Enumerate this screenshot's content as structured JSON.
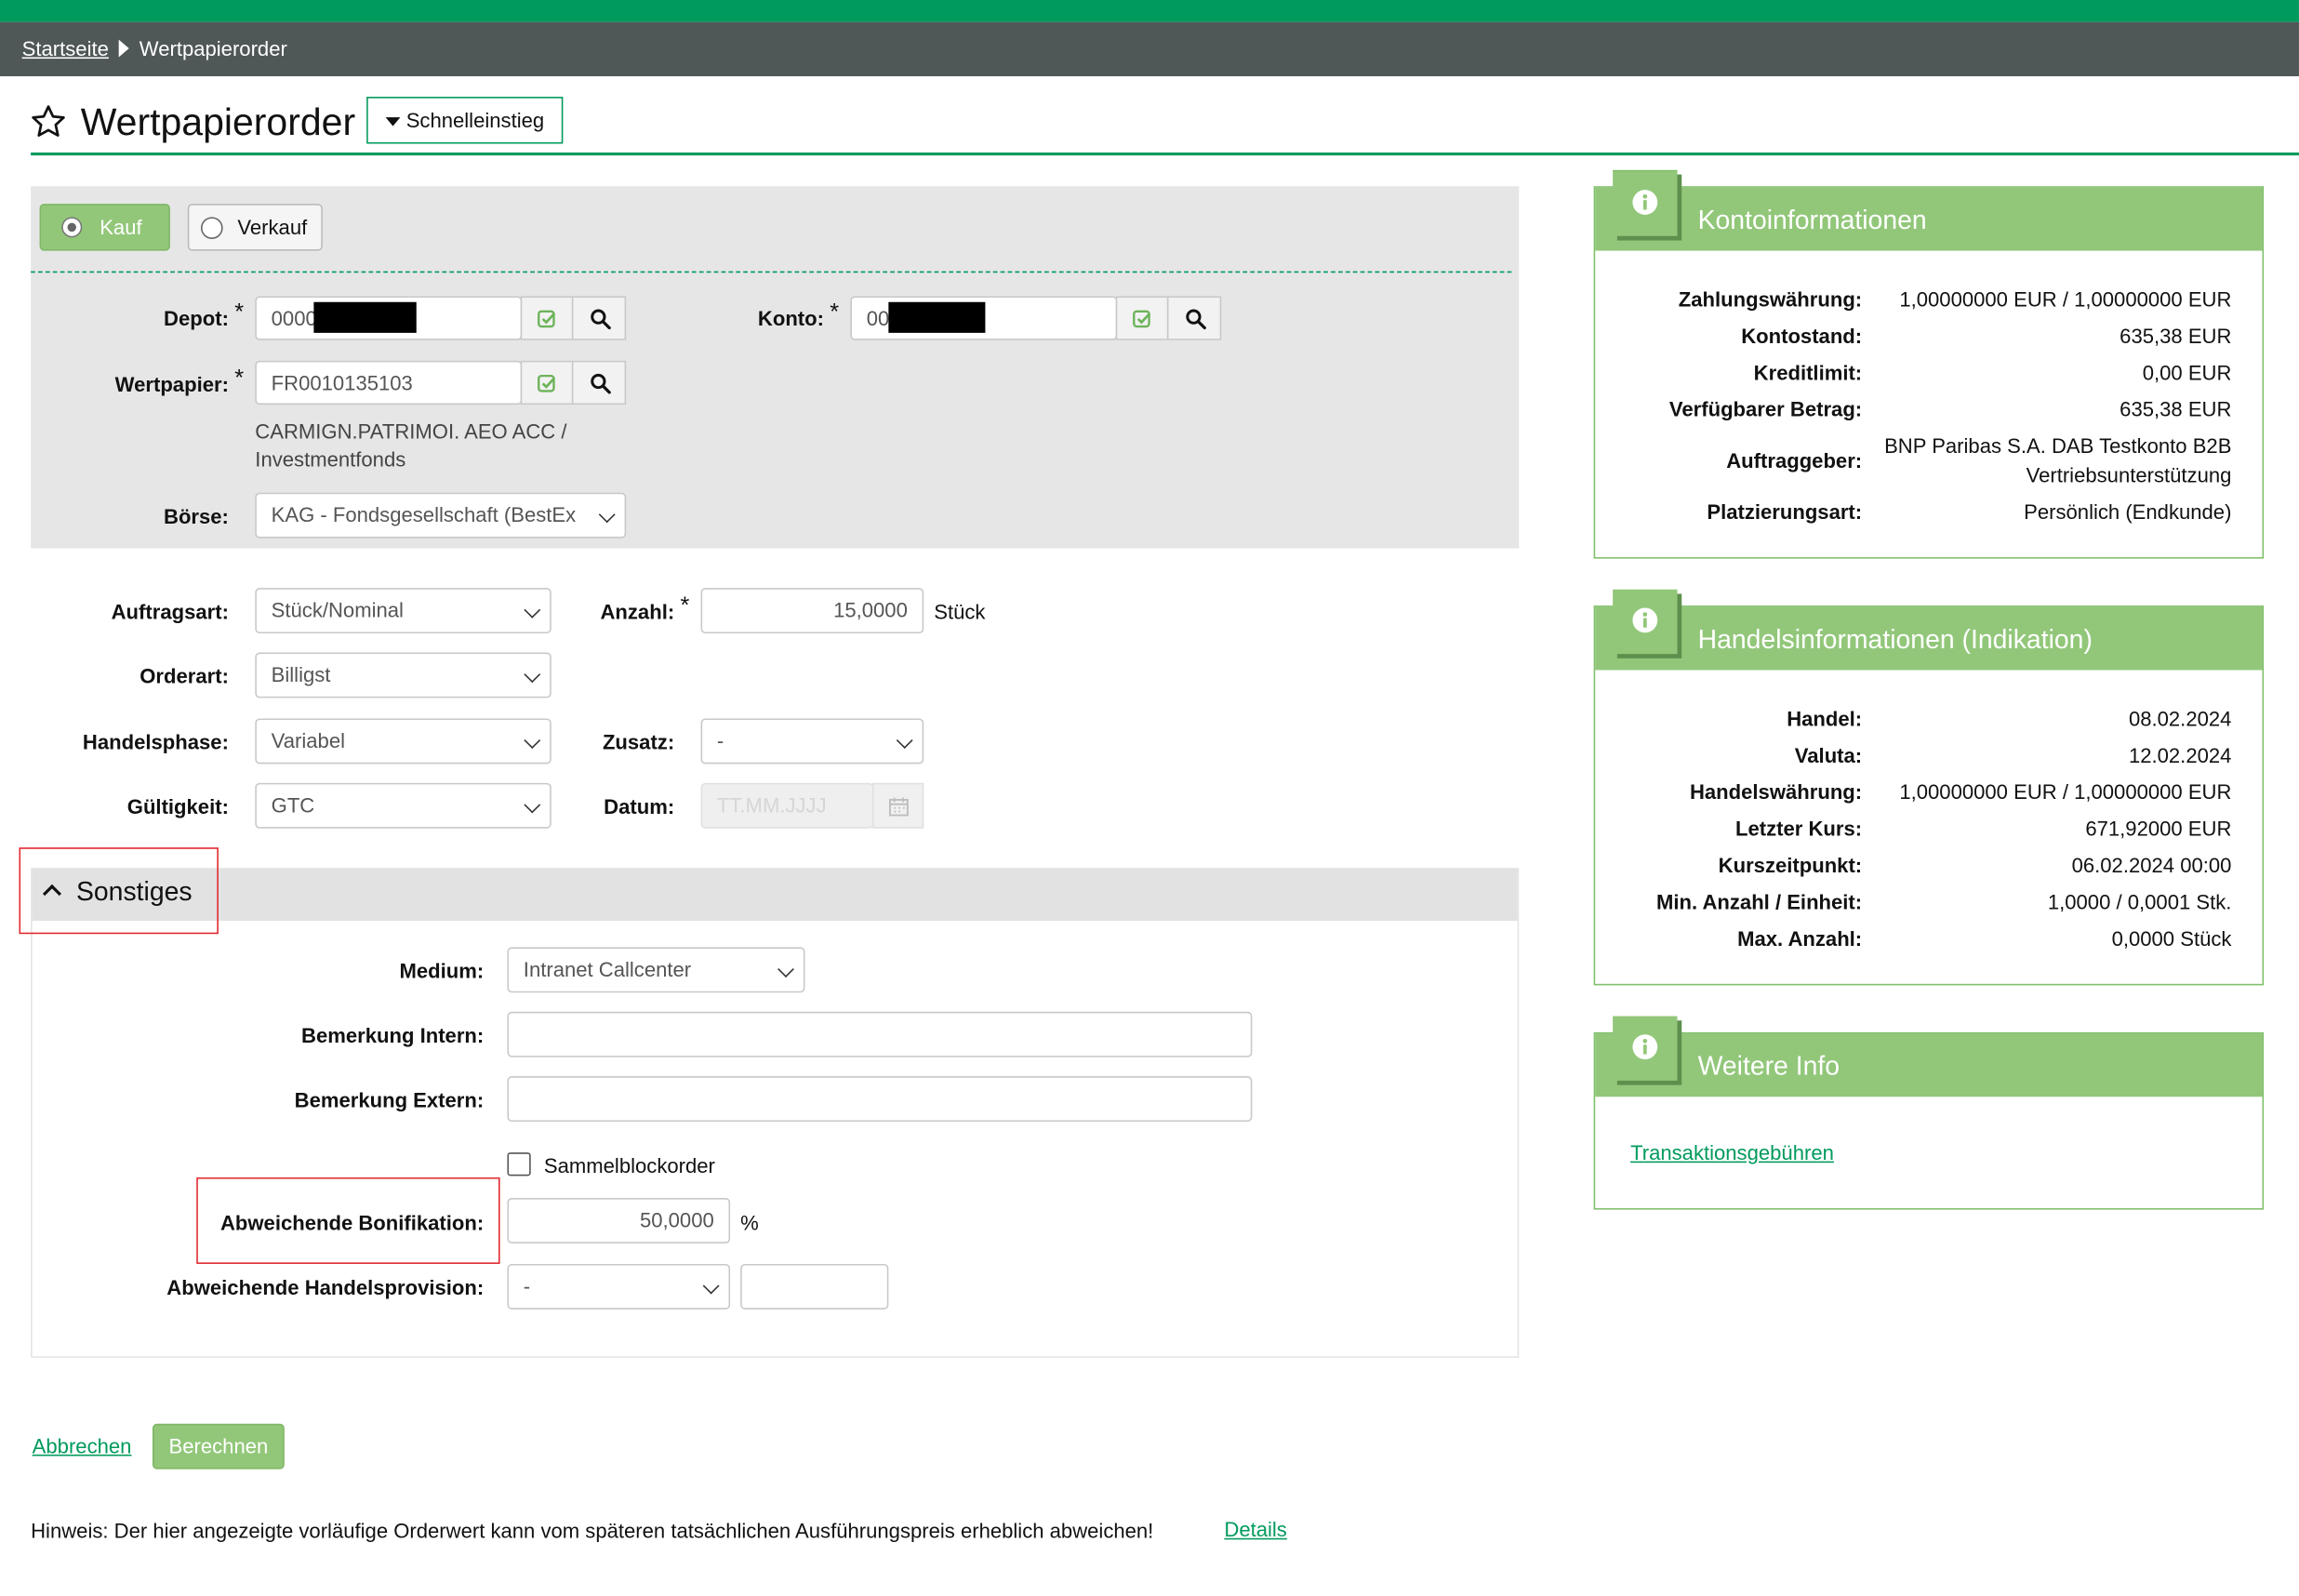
{
  "breadcrumb": {
    "home": "Startseite",
    "current": "Wertpapierorder"
  },
  "page": {
    "title": "Wertpapierorder",
    "quick_entry": "Schnelleinstieg"
  },
  "order_side": {
    "buy": "Kauf",
    "sell": "Verkauf",
    "selected": "Kauf"
  },
  "fields": {
    "depot": {
      "label": "Depot:",
      "value": "0000"
    },
    "konto": {
      "label": "Konto:",
      "value": "00"
    },
    "wertpapier": {
      "label": "Wertpapier:",
      "value": "FR0010135103",
      "desc_line1": "CARMIGN.PATRIMOI. AEO ACC /",
      "desc_line2": "Investmentfonds"
    },
    "boerse": {
      "label": "Börse:",
      "value": "KAG - Fondsgesellschaft (BestEx"
    },
    "auftragsart": {
      "label": "Auftragsart:",
      "value": "Stück/Nominal"
    },
    "anzahl": {
      "label": "Anzahl:",
      "value": "15,0000",
      "unit": "Stück"
    },
    "orderart": {
      "label": "Orderart:",
      "value": "Billigst"
    },
    "handelsphase": {
      "label": "Handelsphase:",
      "value": "Variabel"
    },
    "zusatz": {
      "label": "Zusatz:",
      "value": "-"
    },
    "gueltigkeit": {
      "label": "Gültigkeit:",
      "value": "GTC"
    },
    "datum": {
      "label": "Datum:",
      "placeholder": "TT.MM.JJJJ"
    }
  },
  "sonstiges": {
    "title": "Sonstiges",
    "medium": {
      "label": "Medium:",
      "value": "Intranet Callcenter"
    },
    "bemerkung_intern": {
      "label": "Bemerkung Intern:",
      "value": ""
    },
    "bemerkung_extern": {
      "label": "Bemerkung Extern:",
      "value": ""
    },
    "sammelblock": {
      "label": "Sammelblockorder",
      "checked": false
    },
    "bonifikation": {
      "label": "Abweichende Bonifikation:",
      "value": "50,0000",
      "unit": "%"
    },
    "handelsprovision": {
      "label": "Abweichende Handelsprovision:",
      "value": "-",
      "extra": ""
    }
  },
  "actions": {
    "cancel": "Abbrechen",
    "calculate": "Berechnen"
  },
  "footer": {
    "hint": "Hinweis: Der hier angezeigte vorläufige Orderwert kann vom späteren tatsächlichen Ausführungspreis erheblich abweichen!",
    "details": "Details"
  },
  "kontoinfo": {
    "title": "Kontoinformationen",
    "rows": [
      {
        "label": "Zahlungswährung:",
        "value": "1,00000000 EUR / 1,00000000 EUR"
      },
      {
        "label": "Kontostand:",
        "value": "635,38 EUR"
      },
      {
        "label": "Kreditlimit:",
        "value": "0,00 EUR"
      },
      {
        "label": "Verfügbarer Betrag:",
        "value": "635,38 EUR"
      },
      {
        "label": "Auftraggeber:",
        "value": "BNP Paribas S.A. DAB Testkonto B2B",
        "value2": "Vertriebsunterstützung"
      },
      {
        "label": "Platzierungsart:",
        "value": "Persönlich (Endkunde)"
      }
    ]
  },
  "handelsinfo": {
    "title": "Handelsinformationen (Indikation)",
    "rows": [
      {
        "label": "Handel:",
        "value": "08.02.2024"
      },
      {
        "label": "Valuta:",
        "value": "12.02.2024"
      },
      {
        "label": "Handelswährung:",
        "value": "1,00000000 EUR / 1,00000000 EUR"
      },
      {
        "label": "Letzter Kurs:",
        "value": "671,92000 EUR"
      },
      {
        "label": "Kurszeitpunkt:",
        "value": "06.02.2024 00:00"
      },
      {
        "label": "Min. Anzahl / Einheit:",
        "value": "1,0000 / 0,0001 Stk."
      },
      {
        "label": "Max. Anzahl:",
        "value": "0,0000 Stück"
      }
    ]
  },
  "weitere": {
    "title": "Weitere Info",
    "link": "Transaktionsgebühren"
  },
  "colors": {
    "brand_green": "#009a5c",
    "panel_green": "#92c77a",
    "nav_gray": "#4f5757",
    "highlight_red": "#e0282e"
  },
  "icons": [
    "star-icon",
    "caret-down-icon",
    "check-icon",
    "search-icon",
    "calendar-icon",
    "chevron-up-icon",
    "info-icon"
  ]
}
